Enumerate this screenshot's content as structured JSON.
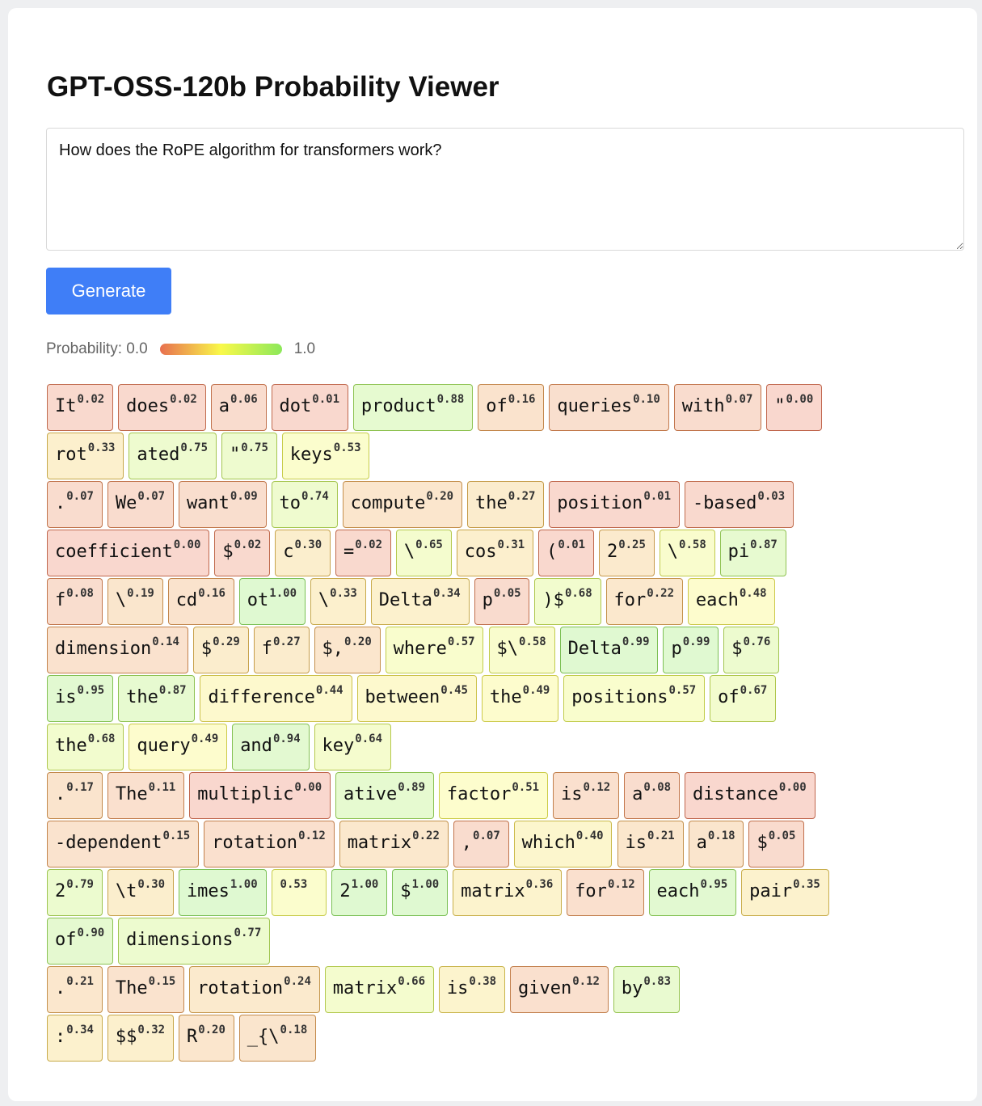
{
  "title": "GPT-OSS-120b Probability Viewer",
  "prompt": {
    "value": "How does the RoPE algorithm for transformers work?"
  },
  "generate_button": {
    "label": "Generate"
  },
  "legend": {
    "label": "Probability: 0.0",
    "max_label": "1.0",
    "low_color": "#e8704f",
    "mid_color": "#f9f94a",
    "high_color": "#8ce85a"
  },
  "token_rows": [
    [
      [
        "It",
        "0.02"
      ],
      [
        "does",
        "0.02"
      ],
      [
        "a",
        "0.06"
      ],
      [
        "dot",
        "0.01"
      ],
      [
        "product",
        "0.88"
      ],
      [
        "of",
        "0.16"
      ],
      [
        "queries",
        "0.10"
      ],
      [
        "with",
        "0.07"
      ],
      [
        "\"",
        "0.00"
      ]
    ],
    [
      [
        "rot",
        "0.33"
      ],
      [
        "ated",
        "0.75"
      ],
      [
        "\"",
        "0.75"
      ],
      [
        "keys",
        "0.53"
      ]
    ],
    [
      [
        ".",
        "0.07"
      ],
      [
        "We",
        "0.07"
      ],
      [
        "want",
        "0.09"
      ],
      [
        "to",
        "0.74"
      ],
      [
        "compute",
        "0.20"
      ],
      [
        "the",
        "0.27"
      ],
      [
        "position",
        "0.01"
      ],
      [
        "-based",
        "0.03"
      ]
    ],
    [
      [
        "coefficient",
        "0.00"
      ],
      [
        "$",
        "0.02"
      ],
      [
        "c",
        "0.30"
      ],
      [
        "=",
        "0.02"
      ],
      [
        "\\",
        "0.65"
      ],
      [
        "cos",
        "0.31"
      ],
      [
        "(",
        "0.01"
      ],
      [
        "2",
        "0.25"
      ],
      [
        "\\",
        "0.58"
      ],
      [
        "pi",
        "0.87"
      ]
    ],
    [
      [
        "f",
        "0.08"
      ],
      [
        "\\",
        "0.19"
      ],
      [
        "cd",
        "0.16"
      ],
      [
        "ot",
        "1.00"
      ],
      [
        "\\",
        "0.33"
      ],
      [
        "Delta",
        "0.34"
      ],
      [
        "p",
        "0.05"
      ],
      [
        ")$",
        "0.68"
      ],
      [
        "for",
        "0.22"
      ],
      [
        "each",
        "0.48"
      ]
    ],
    [
      [
        "dimension",
        "0.14"
      ],
      [
        "$",
        "0.29"
      ],
      [
        "f",
        "0.27"
      ],
      [
        "$,",
        "0.20"
      ],
      [
        "where",
        "0.57"
      ],
      [
        "$\\",
        "0.58"
      ],
      [
        "Delta",
        "0.99"
      ],
      [
        "p",
        "0.99"
      ],
      [
        "$",
        "0.76"
      ]
    ],
    [
      [
        "is",
        "0.95"
      ],
      [
        "the",
        "0.87"
      ],
      [
        "difference",
        "0.44"
      ],
      [
        "between",
        "0.45"
      ],
      [
        "the",
        "0.49"
      ],
      [
        "positions",
        "0.57"
      ],
      [
        "of",
        "0.67"
      ]
    ],
    [
      [
        "the",
        "0.68"
      ],
      [
        "query",
        "0.49"
      ],
      [
        "and",
        "0.94"
      ],
      [
        "key",
        "0.64"
      ]
    ],
    [
      [
        ".",
        "0.17"
      ],
      [
        "The",
        "0.11"
      ],
      [
        "multiplic",
        "0.00"
      ],
      [
        "ative",
        "0.89"
      ],
      [
        "factor",
        "0.51"
      ],
      [
        "is",
        "0.12"
      ],
      [
        "a",
        "0.08"
      ],
      [
        "distance",
        "0.00"
      ]
    ],
    [
      [
        "-dependent",
        "0.15"
      ],
      [
        "rotation",
        "0.12"
      ],
      [
        "matrix",
        "0.22"
      ],
      [
        ",",
        "0.07"
      ],
      [
        "which",
        "0.40"
      ],
      [
        "is",
        "0.21"
      ],
      [
        "a",
        "0.18"
      ],
      [
        "$",
        "0.05"
      ]
    ],
    [
      [
        "2",
        "0.79"
      ],
      [
        "\\t",
        "0.30"
      ],
      [
        "imes",
        "1.00"
      ],
      [
        "",
        "0.53"
      ],
      [
        "2",
        "1.00"
      ],
      [
        "$",
        "1.00"
      ],
      [
        "matrix",
        "0.36"
      ],
      [
        "for",
        "0.12"
      ],
      [
        "each",
        "0.95"
      ],
      [
        "pair",
        "0.35"
      ]
    ],
    [
      [
        "of",
        "0.90"
      ],
      [
        "dimensions",
        "0.77"
      ]
    ],
    [
      [
        ".",
        "0.21"
      ],
      [
        "The",
        "0.15"
      ],
      [
        "rotation",
        "0.24"
      ],
      [
        "matrix",
        "0.66"
      ],
      [
        "is",
        "0.38"
      ],
      [
        "given",
        "0.12"
      ],
      [
        "by",
        "0.83"
      ]
    ],
    [
      [
        ":",
        "0.34"
      ],
      [
        "$$",
        "0.32"
      ],
      [
        "R",
        "0.20"
      ],
      [
        "_{\\",
        "0.18"
      ]
    ]
  ]
}
